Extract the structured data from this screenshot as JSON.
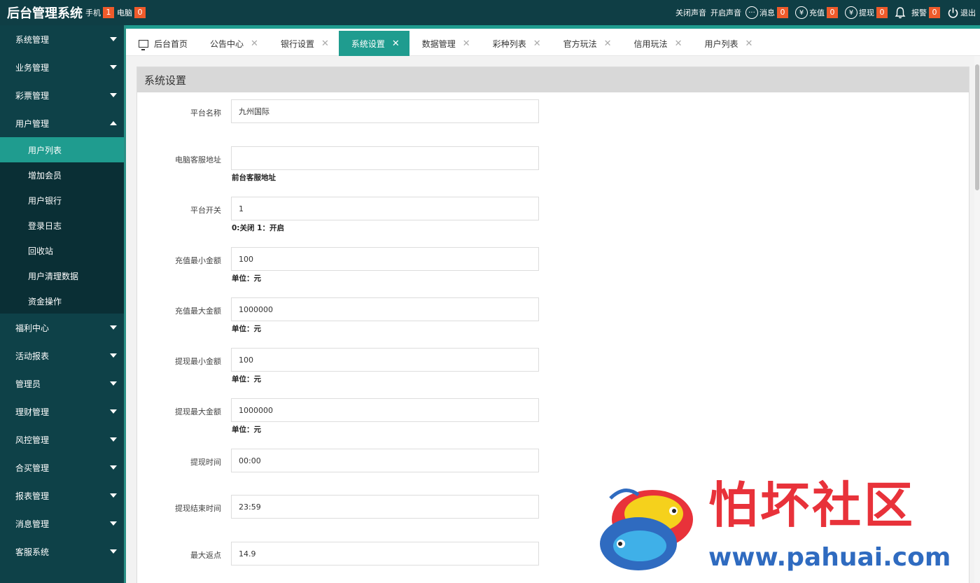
{
  "header": {
    "brand": "后台管理系统",
    "mobile_label": "手机",
    "mobile_count": "1",
    "pc_label": "电脑",
    "pc_count": "0",
    "sound_off": "关闭声音",
    "sound_on": "开启声音",
    "messages_label": "消息",
    "messages_count": "0",
    "recharge_label": "充值",
    "recharge_count": "0",
    "withdraw_label": "提现",
    "withdraw_count": "0",
    "alarm_label": "报警",
    "alarm_count": "0",
    "logout_label": "退出"
  },
  "sidebar": {
    "items": [
      {
        "label": "系统管理"
      },
      {
        "label": "业务管理"
      },
      {
        "label": "彩票管理"
      },
      {
        "label": "用户管理"
      },
      {
        "label": "福利中心"
      },
      {
        "label": "活动报表"
      },
      {
        "label": "管理员"
      },
      {
        "label": "理财管理"
      },
      {
        "label": "风控管理"
      },
      {
        "label": "合买管理"
      },
      {
        "label": "报表管理"
      },
      {
        "label": "消息管理"
      },
      {
        "label": "客服系统"
      }
    ],
    "submenu": [
      {
        "label": "用户列表"
      },
      {
        "label": "增加会员"
      },
      {
        "label": "用户银行"
      },
      {
        "label": "登录日志"
      },
      {
        "label": "回收站"
      },
      {
        "label": "用户清理数据"
      },
      {
        "label": "资金操作"
      }
    ]
  },
  "tabs": [
    {
      "label": "后台首页"
    },
    {
      "label": "公告中心"
    },
    {
      "label": "银行设置"
    },
    {
      "label": "系统设置"
    },
    {
      "label": "数据管理"
    },
    {
      "label": "彩种列表"
    },
    {
      "label": "官方玩法"
    },
    {
      "label": "信用玩法"
    },
    {
      "label": "用户列表"
    }
  ],
  "panel": {
    "title": "系统设置",
    "fields": [
      {
        "label": "平台名称",
        "value": "九州国际",
        "hint": ""
      },
      {
        "label": "电脑客服地址",
        "value": "",
        "hint": "前台客服地址"
      },
      {
        "label": "平台开关",
        "value": "1",
        "hint": "0:关闭 1：开启"
      },
      {
        "label": "充值最小金额",
        "value": "100",
        "hint": "单位：元"
      },
      {
        "label": "充值最大金额",
        "value": "1000000",
        "hint": "单位：元"
      },
      {
        "label": "提现最小金额",
        "value": "100",
        "hint": "单位：元"
      },
      {
        "label": "提现最大金额",
        "value": "1000000",
        "hint": "单位：元"
      },
      {
        "label": "提现时间",
        "value": "00:00",
        "hint": ""
      },
      {
        "label": "提现结束时间",
        "value": "23:59",
        "hint": ""
      },
      {
        "label": "最大返点",
        "value": "14.9",
        "hint": ""
      }
    ]
  },
  "watermark": {
    "title": "怕坏社区",
    "url": "www.pahuai.com"
  },
  "colors": {
    "header_bg": "#0f3e45",
    "sidebar_bg": "#0e4148",
    "accent": "#1f9c8f",
    "badge": "#ef5b2b"
  }
}
